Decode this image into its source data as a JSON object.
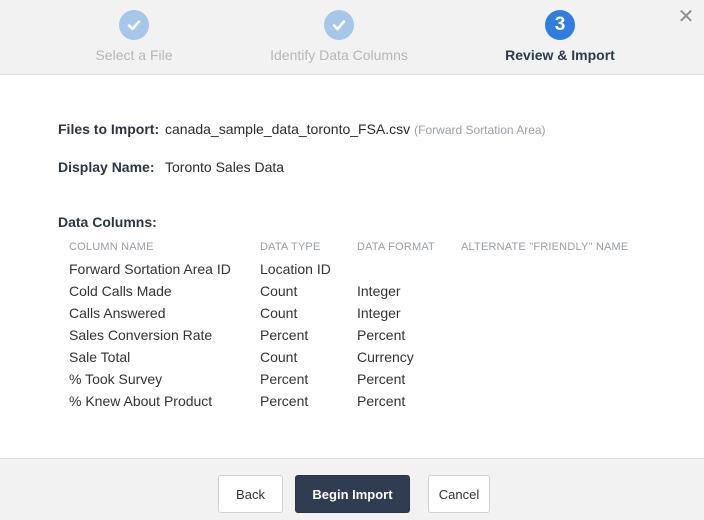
{
  "wizard": {
    "steps": [
      {
        "label": "Select a File",
        "state": "done"
      },
      {
        "label": "Identify Data Columns",
        "state": "done"
      },
      {
        "label": "Review & Import",
        "number": "3",
        "state": "active"
      }
    ],
    "close_icon": "close-icon"
  },
  "review": {
    "files_label": "Files to Import:",
    "file_name": "canada_sample_data_toronto_FSA.csv",
    "file_note": "(Forward Sortation Area)",
    "display_name_label": "Display Name:",
    "display_name_value": "Toronto Sales Data",
    "data_columns_label": "Data Columns:"
  },
  "columns_table": {
    "headers": [
      "COLUMN NAME",
      "DATA TYPE",
      "DATA FORMAT",
      "ALTERNATE \"FRIENDLY\" NAME"
    ],
    "rows": [
      {
        "name": "Forward Sortation Area ID",
        "type": "Location ID",
        "format": ""
      },
      {
        "name": "Cold Calls Made",
        "type": "Count",
        "format": "Integer"
      },
      {
        "name": "Calls Answered",
        "type": "Count",
        "format": "Integer"
      },
      {
        "name": "Sales Conversion Rate",
        "type": "Percent",
        "format": "Percent"
      },
      {
        "name": "Sale Total",
        "type": "Count",
        "format": "Currency"
      },
      {
        "name": "% Took Survey",
        "type": "Percent",
        "format": "Percent"
      },
      {
        "name": "% Knew About Product",
        "type": "Percent",
        "format": "Percent"
      }
    ]
  },
  "footer": {
    "back_label": "Back",
    "begin_import_label": "Begin Import",
    "cancel_label": "Cancel"
  },
  "colors": {
    "step_done": "#a7c7ea",
    "step_active": "#2f7de1",
    "primary_button": "#2f3c52"
  }
}
